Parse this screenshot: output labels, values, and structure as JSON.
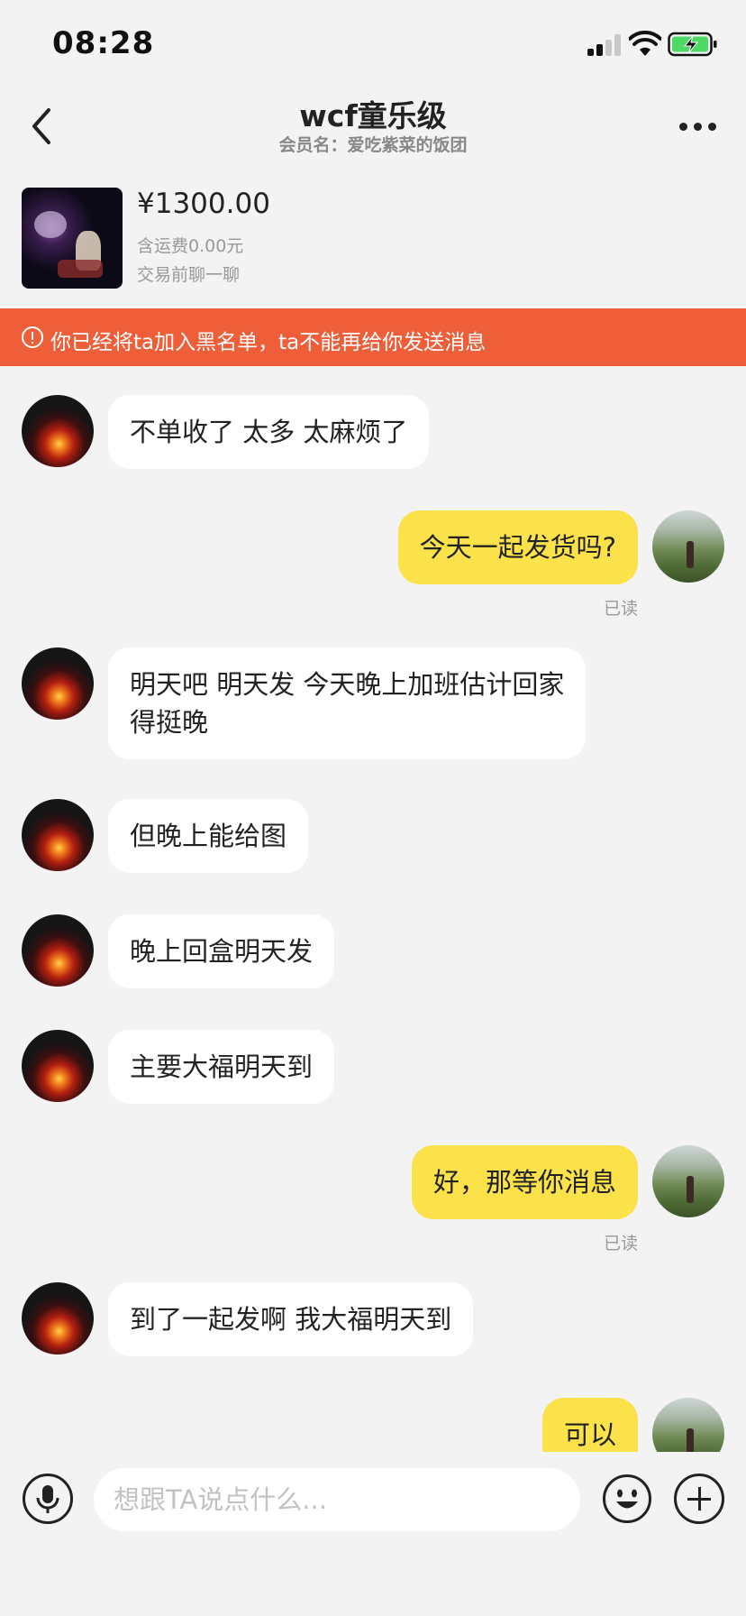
{
  "status_bar": {
    "time": "08:28"
  },
  "header": {
    "title": "wcf童乐级",
    "subtitle": "会员名：爱吃紫菜的饭团"
  },
  "product": {
    "price": "¥1300.00",
    "shipping": "含运费0.00元",
    "note": "交易前聊一聊"
  },
  "banner": {
    "text": "你已经将ta加入黑名单，ta不能再给你发送消息"
  },
  "messages": [
    {
      "from": "them",
      "lines": [
        "不单收了 太多 太麻烦了"
      ]
    },
    {
      "from": "me",
      "lines": [
        "今天一起发货吗?"
      ],
      "read": "已读"
    },
    {
      "from": "them",
      "lines": [
        "明天吧 明天发 今天晚上加班估计回家",
        "得挺晚"
      ]
    },
    {
      "from": "them",
      "lines": [
        "但晚上能给图"
      ]
    },
    {
      "from": "them",
      "lines": [
        "晚上回盒明天发"
      ]
    },
    {
      "from": "them",
      "lines": [
        "主要大福明天到"
      ]
    },
    {
      "from": "me",
      "lines": [
        "好，那等你消息"
      ],
      "read": "已读"
    },
    {
      "from": "them",
      "lines": [
        "到了一起发啊 我大福明天到"
      ]
    },
    {
      "from": "me",
      "lines": [
        "可以"
      ]
    }
  ],
  "input": {
    "placeholder": "想跟TA说点什么..."
  },
  "colors": {
    "banner": "#ee5e38",
    "my_bubble": "#fbe14a",
    "their_bubble": "#ffffff",
    "background": "#f3f3f3"
  }
}
